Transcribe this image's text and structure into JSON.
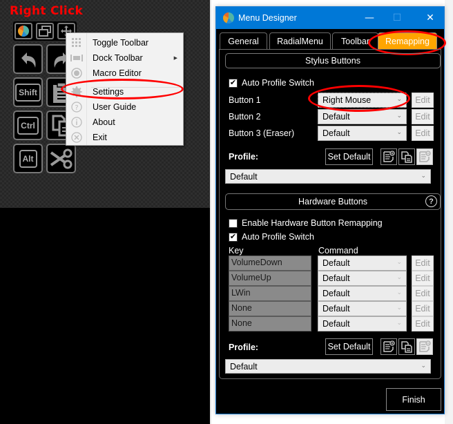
{
  "annotation": {
    "right_click_label": "Right Click",
    "highlight_color": "#ff0000"
  },
  "toolbar": {
    "top_icons": [
      "app-logo-icon",
      "windows-icon",
      "move-icon"
    ],
    "buttons": [
      {
        "name": "undo",
        "icon": "undo-icon"
      },
      {
        "name": "redo",
        "icon": "redo-icon"
      },
      {
        "name": "shift",
        "label": "Shift"
      },
      {
        "name": "paste",
        "icon": "clipboard-icon"
      },
      {
        "name": "ctrl",
        "label": "Ctrl"
      },
      {
        "name": "copy",
        "icon": "copy-icon"
      },
      {
        "name": "alt",
        "label": "Alt"
      },
      {
        "name": "cut",
        "icon": "scissors-icon"
      }
    ]
  },
  "context_menu": {
    "items": [
      {
        "label": "Toggle Toolbar",
        "icon": "grid-icon"
      },
      {
        "label": "Dock Toolbar",
        "icon": "dock-icon",
        "submenu": true
      },
      {
        "label": "Macro Editor",
        "icon": "record-icon"
      },
      {
        "label": "Settings",
        "icon": "gear-icon",
        "highlighted": true
      },
      {
        "label": "User Guide",
        "icon": "help-icon"
      },
      {
        "label": "About",
        "icon": "info-icon"
      },
      {
        "label": "Exit",
        "icon": "close-circle-icon"
      }
    ]
  },
  "window": {
    "title": "Menu Designer",
    "title_bar_color": "#0078d7",
    "controls": {
      "minimize": "—",
      "maximize": "☐",
      "close": "✕"
    },
    "tabs": [
      {
        "label": "General",
        "active": false
      },
      {
        "label": "RadialMenu",
        "active": false
      },
      {
        "label": "Toolbar",
        "active": false
      },
      {
        "label": "Remapping",
        "active": true
      }
    ],
    "active_tab_color": "#ffa500",
    "stylus": {
      "header": "Stylus Buttons",
      "auto_profile_switch": {
        "label": "Auto Profile Switch",
        "checked": true
      },
      "buttons": [
        {
          "label": "Button 1",
          "value": "Right Mouse",
          "edit": "Edit"
        },
        {
          "label": "Button 2",
          "value": "Default",
          "edit": "Edit"
        },
        {
          "label": "Button 3 (Eraser)",
          "value": "Default",
          "edit": "Edit"
        }
      ],
      "profile_label": "Profile:",
      "set_default": "Set Default",
      "profile_value": "Default"
    },
    "hardware": {
      "header": "Hardware Buttons",
      "help": "?",
      "enable_remap": {
        "label": "Enable Hardware Button Remapping",
        "checked": false
      },
      "auto_profile_switch": {
        "label": "Auto Profile Switch",
        "checked": true
      },
      "col_key": "Key",
      "col_command": "Command",
      "rows": [
        {
          "key": "VolumeDown",
          "command": "Default",
          "edit": "Edit"
        },
        {
          "key": "VolumeUp",
          "command": "Default",
          "edit": "Edit"
        },
        {
          "key": "LWin",
          "command": "Default",
          "edit": "Edit"
        },
        {
          "key": "None",
          "command": "Default",
          "edit": "Edit"
        },
        {
          "key": "None",
          "command": "Default",
          "edit": "Edit"
        }
      ],
      "profile_label": "Profile:",
      "set_default": "Set Default",
      "profile_value": "Default"
    },
    "finish": "Finish"
  }
}
